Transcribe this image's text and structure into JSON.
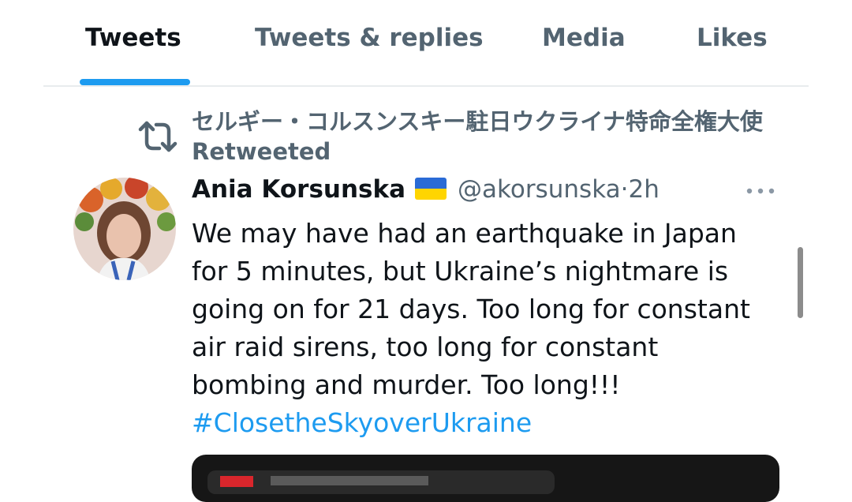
{
  "tabs": [
    {
      "label": "Tweets",
      "active": true
    },
    {
      "label": "Tweets & replies",
      "active": false
    },
    {
      "label": "Media",
      "active": false
    },
    {
      "label": "Likes",
      "active": false
    }
  ],
  "retweet": {
    "icon": "retweet-icon",
    "text": "セルギー・コルスンスキー駐日ウクライナ特命全権大使 Retweeted"
  },
  "tweet": {
    "author_name": "Ania Korsunska",
    "flag": "ukraine-flag",
    "handle": "@akorsunska",
    "separator": "·",
    "time": "2h",
    "more_icon": "more-horizontal-icon",
    "body_lines": [
      "We may have had an earthquake in Japan",
      "for 5 minutes, but Ukraine’s nightmare is",
      "going on for 21 days. Too long for constant",
      "air raid sirens, too long for constant",
      "bombing and murder. Too long!!!"
    ],
    "hashtag": "#ClosetheSkyoverUkraine"
  },
  "colors": {
    "accent": "#1d9bf0",
    "text_primary": "#0f1419",
    "text_secondary": "#536471",
    "flag_blue": "#2a6bd6",
    "flag_yellow": "#ffd500"
  }
}
